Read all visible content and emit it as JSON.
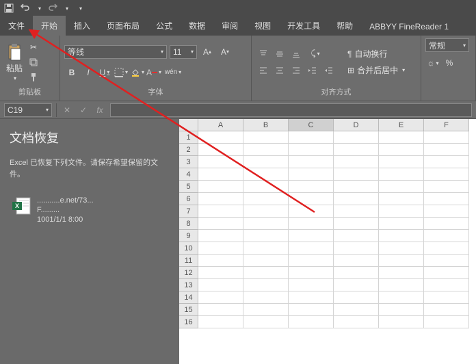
{
  "titlebar": {
    "save_icon": "save",
    "undo_icon": "undo",
    "redo_icon": "redo"
  },
  "tabs": {
    "file": "文件",
    "home": "开始",
    "insert": "插入",
    "layout": "页面布局",
    "formula": "公式",
    "data": "数据",
    "review": "审阅",
    "view": "视图",
    "dev": "开发工具",
    "help": "帮助",
    "abbyy": "ABBYY FineReader 1"
  },
  "ribbon": {
    "clipboard": {
      "label": "剪贴板",
      "paste": "粘贴"
    },
    "font": {
      "label": "字体",
      "name": "等线",
      "size": "11",
      "bold": "B",
      "italic": "I",
      "underline": "U",
      "sample": "A",
      "wen": "wén"
    },
    "align": {
      "label": "对齐方式",
      "wrap": "自动换行",
      "merge": "合并后居中"
    },
    "number": {
      "label": "",
      "format": "常规",
      "percent": "%"
    }
  },
  "namebox": {
    "cell": "C19",
    "fx": "fx"
  },
  "recovery": {
    "title": "文档恢复",
    "desc": "Excel 已恢复下列文件。请保存希望保留的文件。",
    "item": {
      "line1": "...........e.net/73...",
      "line2": "F.........",
      "line3": "1001/1/1 8:00"
    }
  },
  "cols": [
    "A",
    "B",
    "C",
    "D",
    "E",
    "F"
  ],
  "rows": [
    "1",
    "2",
    "3",
    "4",
    "5",
    "6",
    "7",
    "8",
    "9",
    "10",
    "11",
    "12",
    "13",
    "14",
    "15",
    "16"
  ],
  "sel_col": 2
}
